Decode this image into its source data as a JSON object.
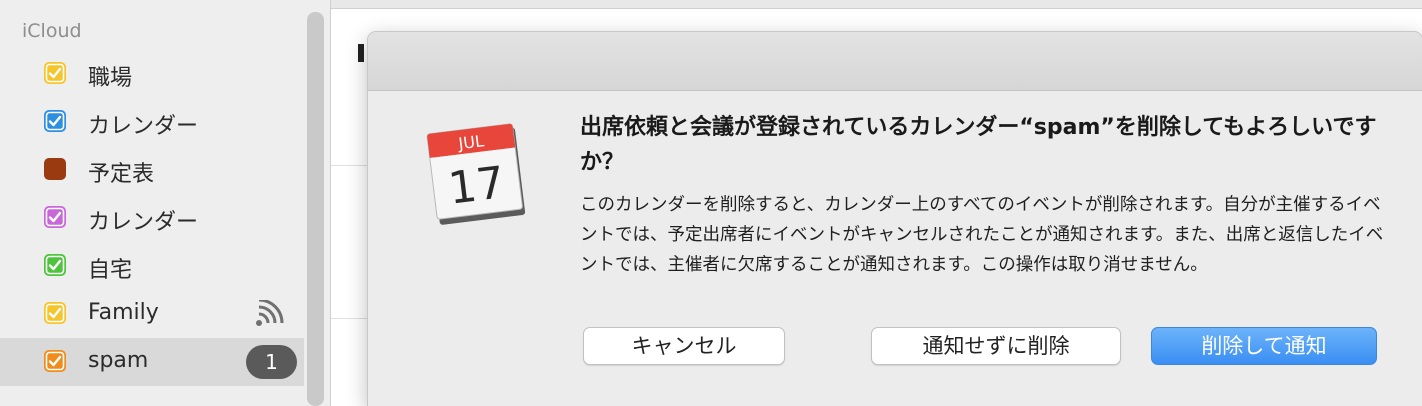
{
  "sidebar": {
    "group_title": "iCloud",
    "items": [
      {
        "label": "職場",
        "color": "#f6c42b",
        "checked": true
      },
      {
        "label": "カレンダー",
        "color": "#2d8fe0",
        "checked": true
      },
      {
        "label": "予定表",
        "color": "#9a3a10",
        "checked": false
      },
      {
        "label": "カレンダー",
        "color": "#c868d8",
        "checked": true
      },
      {
        "label": "自宅",
        "color": "#4dc43c",
        "checked": true
      },
      {
        "label": "Family",
        "color": "#f6c42b",
        "checked": true,
        "indicator_icon": "shared-broadcast-icon"
      },
      {
        "label": "spam",
        "color": "#f08c1c",
        "checked": true,
        "badge": "1",
        "selected": true
      }
    ]
  },
  "dialog": {
    "icon": {
      "name": "calendar-app-icon",
      "month": "JUL",
      "day": "17"
    },
    "heading": "出席依頼と会議が登録されているカレンダー“spam”を削除してもよろしいですか？",
    "body": "このカレンダーを削除すると、カレンダー上のすべてのイベントが削除されます。自分が主催するイベントでは、予定出席者にイベントがキャンセルされたことが通知されます。また、出席と返信したイベントでは、主催者に欠席することが通知されます。この操作は取り消せません。",
    "buttons": {
      "cancel": "キャンセル",
      "delete_without_notify": "通知せずに削除",
      "delete_and_notify": "削除して通知"
    },
    "accent_color": "#3a8ff3"
  }
}
